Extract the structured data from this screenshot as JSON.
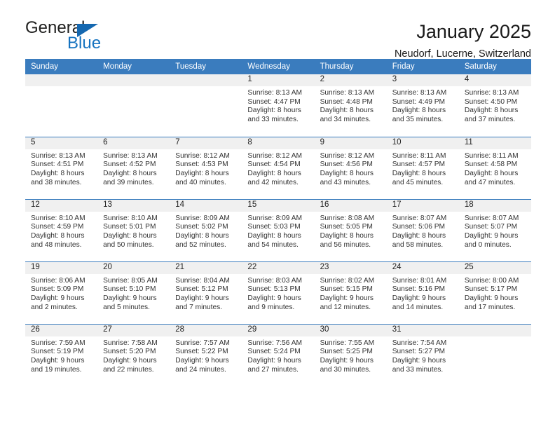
{
  "brand": {
    "name_top": "General",
    "name_bottom": "Blue",
    "accent_color": "#1673c0",
    "header_color": "#3a7cbe"
  },
  "header": {
    "title": "January 2025",
    "subtitle": "Neudorf, Lucerne, Switzerland"
  },
  "weekday_headers": [
    "Sunday",
    "Monday",
    "Tuesday",
    "Wednesday",
    "Thursday",
    "Friday",
    "Saturday"
  ],
  "weeks": [
    [
      {
        "day": "",
        "blank": true,
        "sunrise": "",
        "sunset": "",
        "daylight1": "",
        "daylight2": ""
      },
      {
        "day": "",
        "blank": true,
        "sunrise": "",
        "sunset": "",
        "daylight1": "",
        "daylight2": ""
      },
      {
        "day": "",
        "blank": true,
        "sunrise": "",
        "sunset": "",
        "daylight1": "",
        "daylight2": ""
      },
      {
        "day": "1",
        "blank": false,
        "sunrise": "Sunrise: 8:13 AM",
        "sunset": "Sunset: 4:47 PM",
        "daylight1": "Daylight: 8 hours",
        "daylight2": "and 33 minutes."
      },
      {
        "day": "2",
        "blank": false,
        "sunrise": "Sunrise: 8:13 AM",
        "sunset": "Sunset: 4:48 PM",
        "daylight1": "Daylight: 8 hours",
        "daylight2": "and 34 minutes."
      },
      {
        "day": "3",
        "blank": false,
        "sunrise": "Sunrise: 8:13 AM",
        "sunset": "Sunset: 4:49 PM",
        "daylight1": "Daylight: 8 hours",
        "daylight2": "and 35 minutes."
      },
      {
        "day": "4",
        "blank": false,
        "sunrise": "Sunrise: 8:13 AM",
        "sunset": "Sunset: 4:50 PM",
        "daylight1": "Daylight: 8 hours",
        "daylight2": "and 37 minutes."
      }
    ],
    [
      {
        "day": "5",
        "blank": false,
        "sunrise": "Sunrise: 8:13 AM",
        "sunset": "Sunset: 4:51 PM",
        "daylight1": "Daylight: 8 hours",
        "daylight2": "and 38 minutes."
      },
      {
        "day": "6",
        "blank": false,
        "sunrise": "Sunrise: 8:13 AM",
        "sunset": "Sunset: 4:52 PM",
        "daylight1": "Daylight: 8 hours",
        "daylight2": "and 39 minutes."
      },
      {
        "day": "7",
        "blank": false,
        "sunrise": "Sunrise: 8:12 AM",
        "sunset": "Sunset: 4:53 PM",
        "daylight1": "Daylight: 8 hours",
        "daylight2": "and 40 minutes."
      },
      {
        "day": "8",
        "blank": false,
        "sunrise": "Sunrise: 8:12 AM",
        "sunset": "Sunset: 4:54 PM",
        "daylight1": "Daylight: 8 hours",
        "daylight2": "and 42 minutes."
      },
      {
        "day": "9",
        "blank": false,
        "sunrise": "Sunrise: 8:12 AM",
        "sunset": "Sunset: 4:56 PM",
        "daylight1": "Daylight: 8 hours",
        "daylight2": "and 43 minutes."
      },
      {
        "day": "10",
        "blank": false,
        "sunrise": "Sunrise: 8:11 AM",
        "sunset": "Sunset: 4:57 PM",
        "daylight1": "Daylight: 8 hours",
        "daylight2": "and 45 minutes."
      },
      {
        "day": "11",
        "blank": false,
        "sunrise": "Sunrise: 8:11 AM",
        "sunset": "Sunset: 4:58 PM",
        "daylight1": "Daylight: 8 hours",
        "daylight2": "and 47 minutes."
      }
    ],
    [
      {
        "day": "12",
        "blank": false,
        "sunrise": "Sunrise: 8:10 AM",
        "sunset": "Sunset: 4:59 PM",
        "daylight1": "Daylight: 8 hours",
        "daylight2": "and 48 minutes."
      },
      {
        "day": "13",
        "blank": false,
        "sunrise": "Sunrise: 8:10 AM",
        "sunset": "Sunset: 5:01 PM",
        "daylight1": "Daylight: 8 hours",
        "daylight2": "and 50 minutes."
      },
      {
        "day": "14",
        "blank": false,
        "sunrise": "Sunrise: 8:09 AM",
        "sunset": "Sunset: 5:02 PM",
        "daylight1": "Daylight: 8 hours",
        "daylight2": "and 52 minutes."
      },
      {
        "day": "15",
        "blank": false,
        "sunrise": "Sunrise: 8:09 AM",
        "sunset": "Sunset: 5:03 PM",
        "daylight1": "Daylight: 8 hours",
        "daylight2": "and 54 minutes."
      },
      {
        "day": "16",
        "blank": false,
        "sunrise": "Sunrise: 8:08 AM",
        "sunset": "Sunset: 5:05 PM",
        "daylight1": "Daylight: 8 hours",
        "daylight2": "and 56 minutes."
      },
      {
        "day": "17",
        "blank": false,
        "sunrise": "Sunrise: 8:07 AM",
        "sunset": "Sunset: 5:06 PM",
        "daylight1": "Daylight: 8 hours",
        "daylight2": "and 58 minutes."
      },
      {
        "day": "18",
        "blank": false,
        "sunrise": "Sunrise: 8:07 AM",
        "sunset": "Sunset: 5:07 PM",
        "daylight1": "Daylight: 9 hours",
        "daylight2": "and 0 minutes."
      }
    ],
    [
      {
        "day": "19",
        "blank": false,
        "sunrise": "Sunrise: 8:06 AM",
        "sunset": "Sunset: 5:09 PM",
        "daylight1": "Daylight: 9 hours",
        "daylight2": "and 2 minutes."
      },
      {
        "day": "20",
        "blank": false,
        "sunrise": "Sunrise: 8:05 AM",
        "sunset": "Sunset: 5:10 PM",
        "daylight1": "Daylight: 9 hours",
        "daylight2": "and 5 minutes."
      },
      {
        "day": "21",
        "blank": false,
        "sunrise": "Sunrise: 8:04 AM",
        "sunset": "Sunset: 5:12 PM",
        "daylight1": "Daylight: 9 hours",
        "daylight2": "and 7 minutes."
      },
      {
        "day": "22",
        "blank": false,
        "sunrise": "Sunrise: 8:03 AM",
        "sunset": "Sunset: 5:13 PM",
        "daylight1": "Daylight: 9 hours",
        "daylight2": "and 9 minutes."
      },
      {
        "day": "23",
        "blank": false,
        "sunrise": "Sunrise: 8:02 AM",
        "sunset": "Sunset: 5:15 PM",
        "daylight1": "Daylight: 9 hours",
        "daylight2": "and 12 minutes."
      },
      {
        "day": "24",
        "blank": false,
        "sunrise": "Sunrise: 8:01 AM",
        "sunset": "Sunset: 5:16 PM",
        "daylight1": "Daylight: 9 hours",
        "daylight2": "and 14 minutes."
      },
      {
        "day": "25",
        "blank": false,
        "sunrise": "Sunrise: 8:00 AM",
        "sunset": "Sunset: 5:17 PM",
        "daylight1": "Daylight: 9 hours",
        "daylight2": "and 17 minutes."
      }
    ],
    [
      {
        "day": "26",
        "blank": false,
        "sunrise": "Sunrise: 7:59 AM",
        "sunset": "Sunset: 5:19 PM",
        "daylight1": "Daylight: 9 hours",
        "daylight2": "and 19 minutes."
      },
      {
        "day": "27",
        "blank": false,
        "sunrise": "Sunrise: 7:58 AM",
        "sunset": "Sunset: 5:20 PM",
        "daylight1": "Daylight: 9 hours",
        "daylight2": "and 22 minutes."
      },
      {
        "day": "28",
        "blank": false,
        "sunrise": "Sunrise: 7:57 AM",
        "sunset": "Sunset: 5:22 PM",
        "daylight1": "Daylight: 9 hours",
        "daylight2": "and 24 minutes."
      },
      {
        "day": "29",
        "blank": false,
        "sunrise": "Sunrise: 7:56 AM",
        "sunset": "Sunset: 5:24 PM",
        "daylight1": "Daylight: 9 hours",
        "daylight2": "and 27 minutes."
      },
      {
        "day": "30",
        "blank": false,
        "sunrise": "Sunrise: 7:55 AM",
        "sunset": "Sunset: 5:25 PM",
        "daylight1": "Daylight: 9 hours",
        "daylight2": "and 30 minutes."
      },
      {
        "day": "31",
        "blank": false,
        "sunrise": "Sunrise: 7:54 AM",
        "sunset": "Sunset: 5:27 PM",
        "daylight1": "Daylight: 9 hours",
        "daylight2": "and 33 minutes."
      },
      {
        "day": "",
        "blank": true,
        "sunrise": "",
        "sunset": "",
        "daylight1": "",
        "daylight2": ""
      }
    ]
  ]
}
